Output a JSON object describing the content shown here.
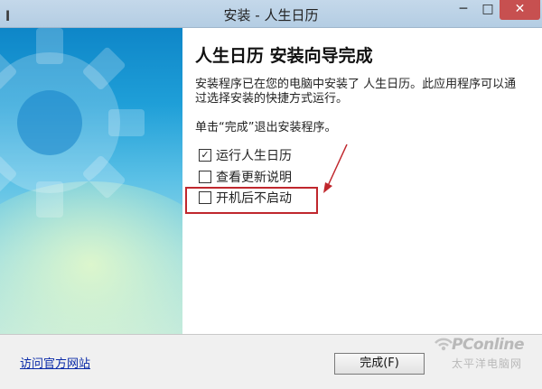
{
  "window": {
    "title": "安装 - 人生日历",
    "minimize_glyph": "─",
    "maximize_glyph": "□",
    "close_glyph": "✕"
  },
  "wizard": {
    "heading": "人生日历 安装向导完成",
    "description": "安装程序已在您的电脑中安装了 人生日历。此应用程序可以通过选择安装的快捷方式运行。",
    "hint": "单击“完成”退出安装程序。",
    "options": [
      {
        "label": "运行人生日历",
        "checked": true
      },
      {
        "label": "查看更新说明",
        "checked": false
      },
      {
        "label": "开机后不启动",
        "checked": false
      }
    ]
  },
  "footer": {
    "link_label": "访问官方网站",
    "finish_label": "完成(F)"
  },
  "watermark": {
    "brand": "PConline",
    "sub": "太平洋电脑网"
  },
  "colors": {
    "highlight": "#c0272d",
    "banner_top": "#0e86c8",
    "link": "#0a2aa8"
  }
}
